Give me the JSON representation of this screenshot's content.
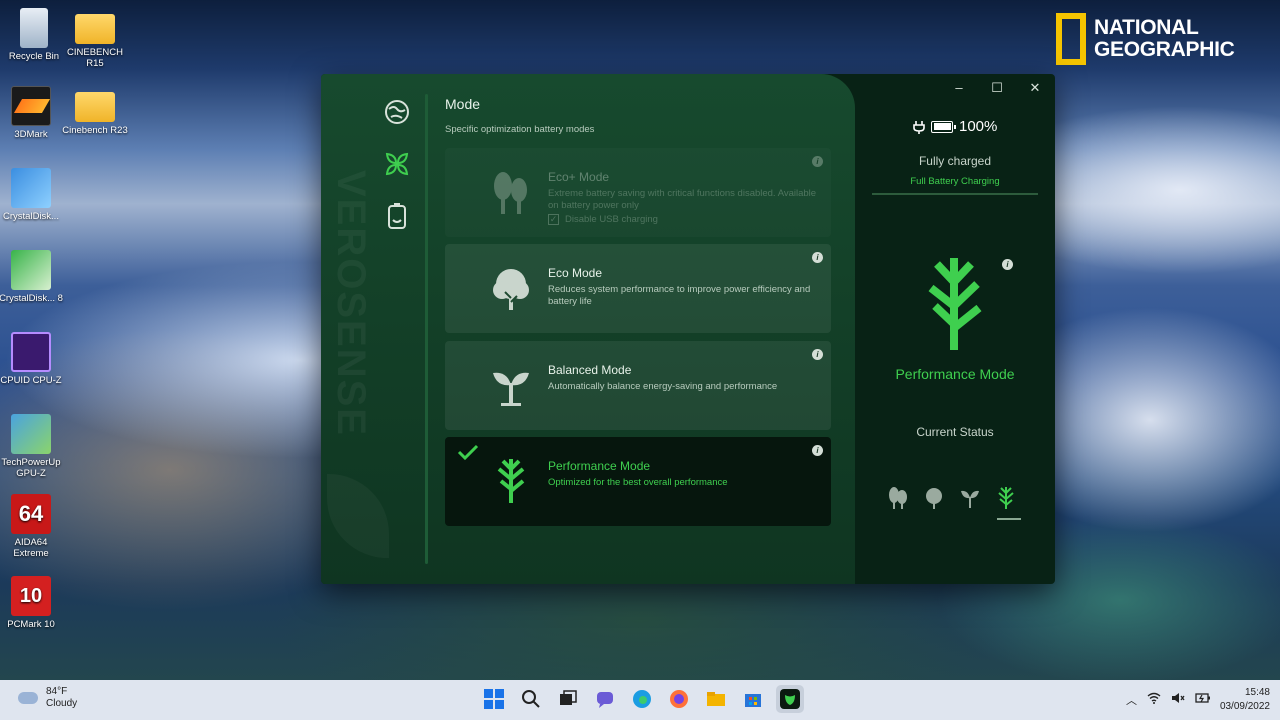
{
  "desktop": {
    "icons": [
      {
        "label": "Recycle Bin"
      },
      {
        "label": "CINEBENCH R15"
      },
      {
        "label": "3DMark"
      },
      {
        "label": "Cinebench R23"
      },
      {
        "label": "CrystalDisk..."
      },
      {
        "label": "CrystalDisk... 8"
      },
      {
        "label": "CPUID CPU-Z"
      },
      {
        "label": "TechPowerUp GPU-Z"
      },
      {
        "label": "AIDA64 Extreme"
      },
      {
        "label": "PCMark 10"
      }
    ],
    "brand": {
      "line1": "NATIONAL",
      "line2": "GEOGRAPHIC"
    }
  },
  "app": {
    "brand_vertical": "VEROSENSE",
    "title": "Mode",
    "subtitle": "Specific optimization battery modes",
    "modes": [
      {
        "title": "Eco+ Mode",
        "desc": "Extreme battery saving with critical functions disabled. Available on battery power only",
        "checkbox_label": "Disable USB charging",
        "state": "disabled"
      },
      {
        "title": "Eco Mode",
        "desc": "Reduces system performance to improve power efficiency and battery life",
        "state": "normal"
      },
      {
        "title": "Balanced Mode",
        "desc": "Automatically balance energy-saving and performance",
        "state": "normal"
      },
      {
        "title": "Performance Mode",
        "desc": "Optimized for the best overall performance",
        "state": "active"
      }
    ],
    "info_glyph": "i",
    "window_controls": {
      "minimize": "–",
      "maximize": "☐",
      "close": "✕"
    },
    "battery": {
      "percent": "100%",
      "status": "Fully charged",
      "charge_mode": "Full Battery Charging"
    },
    "current": {
      "mode_label": "Performance Mode",
      "status_label": "Current Status"
    },
    "accent_color": "#3fcf4f"
  },
  "taskbar": {
    "weather": {
      "temp": "84°F",
      "condition": "Cloudy"
    },
    "clock": {
      "time": "15:48",
      "date": "03/09/2022"
    }
  }
}
